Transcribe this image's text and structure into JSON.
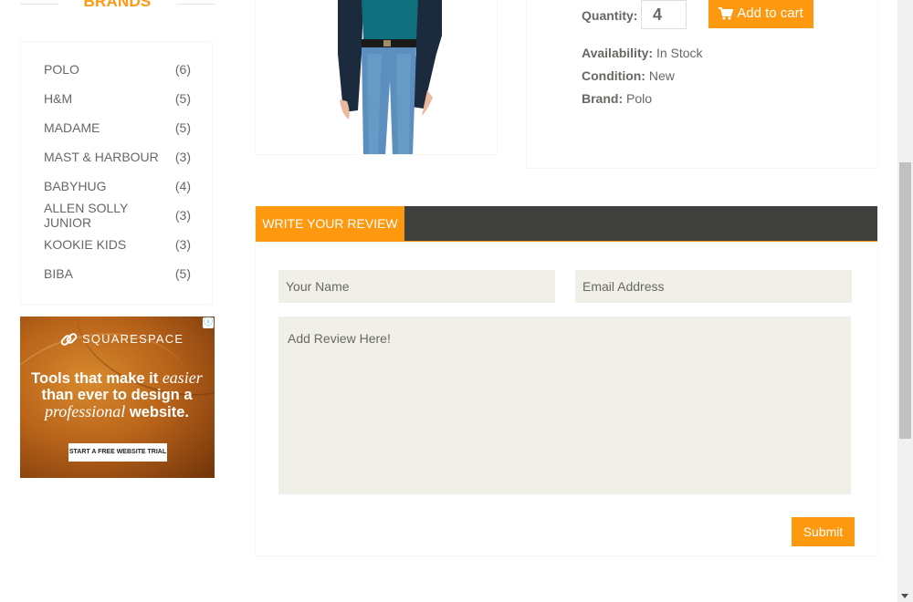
{
  "sidebar": {
    "brands_title": "BRANDS",
    "brands": [
      {
        "name": "POLO",
        "count": "(6)"
      },
      {
        "name": "H&M",
        "count": "(5)"
      },
      {
        "name": "MADAME",
        "count": "(5)"
      },
      {
        "name": "MAST & HARBOUR",
        "count": "(3)"
      },
      {
        "name": "BABYHUG",
        "count": "(4)"
      },
      {
        "name": "ALLEN SOLLY JUNIOR",
        "count": "(3)"
      },
      {
        "name": "KOOKIE KIDS",
        "count": "(3)"
      },
      {
        "name": "BIBA",
        "count": "(5)"
      }
    ]
  },
  "ad": {
    "brand": "SQUARESPACE",
    "line1_a": "Tools that make it ",
    "line1_b": "easier",
    "line2": "than ever to design a",
    "line3_a": "professional",
    "line3_b": " website.",
    "cta": "START A FREE WEBSITE TRIAL",
    "info_icon": "ⓘ"
  },
  "product": {
    "quantity_label": "Quantity:",
    "quantity_value": "4",
    "add_to_cart": "Add to cart",
    "availability_label": "Availability:",
    "availability_value": "In Stock",
    "condition_label": "Condition:",
    "condition_value": "New",
    "brand_label": "Brand:",
    "brand_value": "Polo"
  },
  "review": {
    "tab_label": "WRITE YOUR REVIEW",
    "name_placeholder": "Your Name",
    "email_placeholder": "Email Address",
    "review_placeholder": "Add Review Here!",
    "submit_label": "Submit"
  },
  "colors": {
    "accent": "#fe980f",
    "dark_bar": "#40403e",
    "field_bg": "#f0f0e9",
    "text": "#696763"
  }
}
